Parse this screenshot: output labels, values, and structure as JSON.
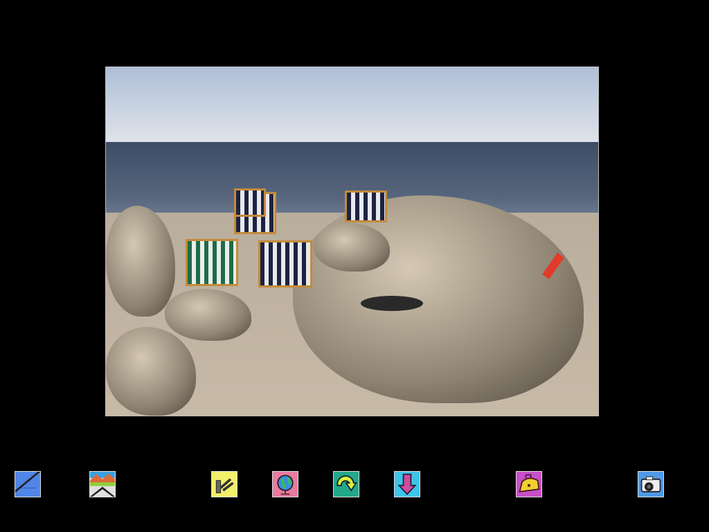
{
  "viewer": {
    "photo": {
      "subject": "beach-photo"
    },
    "toolbar": [
      {
        "icon": "notebook-pencil-icon",
        "color": "#4f86e8"
      },
      {
        "icon": "landscape-icon",
        "color": "#e0e0e0"
      },
      {
        "icon": "tools-icon",
        "color": "#f2ef6a"
      },
      {
        "icon": "globe-icon",
        "color": "#e87aa0"
      },
      {
        "icon": "rotate-arrow-icon",
        "color": "#23a88a"
      },
      {
        "icon": "down-arrow-icon",
        "color": "#3fc4e8"
      },
      {
        "icon": "toolbox-icon",
        "color": "#c84fc8"
      },
      {
        "icon": "camera-icon",
        "color": "#4f9ae8"
      }
    ]
  }
}
